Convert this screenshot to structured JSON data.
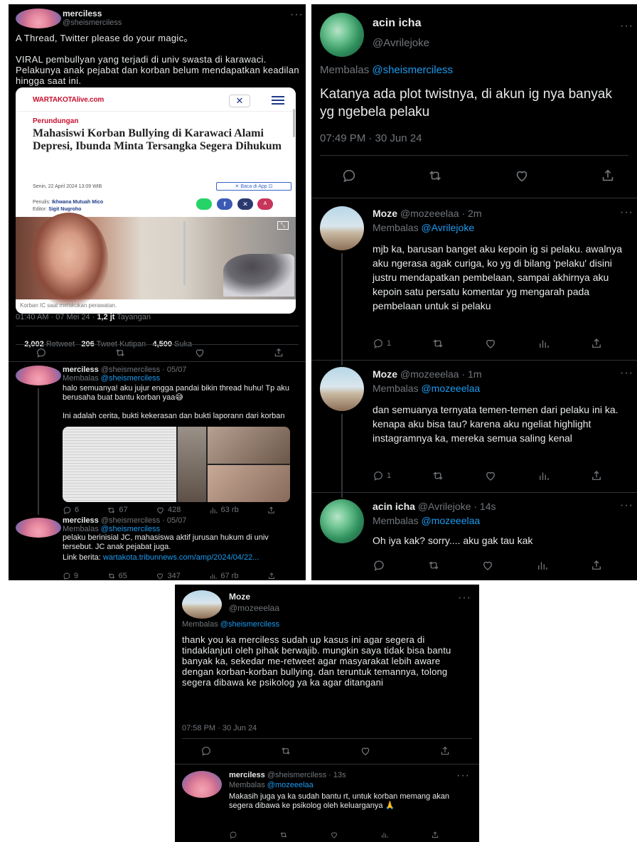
{
  "p1": {
    "author": {
      "name": "merciless",
      "handle": "@sheismerciless"
    },
    "body": "A Thread, Twitter please do your magic。\n\nVIRAL pembullyan yang terjadi di univ swasta di karawaci. Pelakunya anak pejabat dan korban belum mendapatkan keadilan hingga saat ini.",
    "embed": {
      "site": "WARTAKOTAlive.com",
      "category": "Perundungan",
      "headline": "Mahasiswi Korban Bullying di Karawaci Alami Depresi, Ibunda Minta Tersangka Segera Dihukum",
      "date": "Senin, 22 April 2024 13:09 WIB",
      "app_button": "Baca di App",
      "writer_label": "Penulis:",
      "writer": "Ikhwana Mutuah Mico",
      "editor_label": "Editor:",
      "editor": "Sigit Nugroho",
      "caption": "Korban IC saat melakukan perawatan."
    },
    "meta": {
      "time": "01:40 AM · 07 Mei 24 · ",
      "views": "1,2 jt",
      "views_label": " Tayangan"
    },
    "stats": {
      "retweets": "2,002",
      "retweets_label": " Retweet",
      "quotes": "206",
      "quotes_label": " Tweet Kutipan",
      "likes": "4,500",
      "likes_label": " Suka"
    },
    "reply1": {
      "name": "merciless",
      "meta": "@sheismerciless · 05/07",
      "replying": "Membalas ",
      "replying_to": "@sheismerciless",
      "body": "halo semuanya! aku jujur engga pandai bikin thread huhu! Tp aku berusaha buat bantu korban yaa😅\n\nIni adalah cerita, bukti kekerasan dan bukti laporann dari korban",
      "actions": {
        "replies": "6",
        "retweets": "67",
        "likes": "428",
        "views": "63 rb"
      }
    },
    "reply2": {
      "name": "merciless",
      "meta": "@sheismerciless · 05/07",
      "replying": "Membalas ",
      "replying_to": "@sheismerciless",
      "body": "pelaku berinisial JC, mahasiswa aktif jurusan hukum di univ tersebut. JC anak pejabat juga.",
      "link_label": "Link berita: ",
      "link": "wartakota.tribunnews.com/amp/2024/04/22...",
      "actions": {
        "replies": "9",
        "retweets": "65",
        "likes": "347",
        "views": "67 rb"
      }
    }
  },
  "p2": {
    "main": {
      "name": "acin icha",
      "handle": "@Avrilejoke",
      "replying": "Membalas ",
      "replying_to": "@sheismerciless",
      "body": "Katanya ada plot twistnya, di akun ig nya banyak yg ngebela pelaku",
      "time": "07:49 PM · 30 Jun 24"
    },
    "r1": {
      "name": "Moze",
      "meta": "@mozeeelaa · 2m",
      "replying": "Membalas ",
      "replying_to": "@Avrilejoke",
      "body": "mjb ka, barusan banget aku kepoin ig si pelaku. awalnya aku ngerasa agak curiga, ko yg di bilang 'pelaku' disini justru mendapatkan pembelaan, sampai akhirnya aku kepoin satu persatu komentar yg mengarah pada pembelaan untuk si pelaku",
      "replies": "1"
    },
    "r2": {
      "name": "Moze",
      "meta": "@mozeeelaa · 1m",
      "replying": "Membalas ",
      "replying_to": "@mozeeelaa",
      "body": "dan semuanya ternyata temen-temen dari pelaku ini ka. kenapa aku bisa tau? karena aku ngeliat highlight instagramnya ka, mereka semua saling kenal",
      "replies": "1"
    },
    "r3": {
      "name": "acin icha",
      "meta": "@Avrilejoke · 14s",
      "replying": "Membalas ",
      "replying_to": "@mozeeelaa",
      "body": "Oh iya kak? sorry.... aku gak tau kak"
    }
  },
  "p3": {
    "main": {
      "name": "Moze",
      "handle": "@mozeeelaa",
      "replying": "Membalas ",
      "replying_to": "@sheismerciless",
      "body": "thank you ka merciless sudah up kasus ini agar segera di tindaklanjuti oleh pihak berwajib. mungkin saya tidak bisa bantu banyak ka, sekedar me-retweet agar masyarakat lebih aware dengan korban-korban bullying. dan teruntuk temannya, tolong segera dibawa ke psikolog ya ka agar ditangani",
      "time": "07:58 PM · 30 Jun 24"
    },
    "r1": {
      "name": "merciless",
      "meta": "@sheismerciless · 13s",
      "replying": "Membalas ",
      "replying_to": "@mozeeelaa",
      "body": "Makasih juga ya ka sudah bantu rt, untuk korban memang akan segera dibawa ke psikolog oleh keluarganya 🙏"
    }
  },
  "more_glyph": "···"
}
